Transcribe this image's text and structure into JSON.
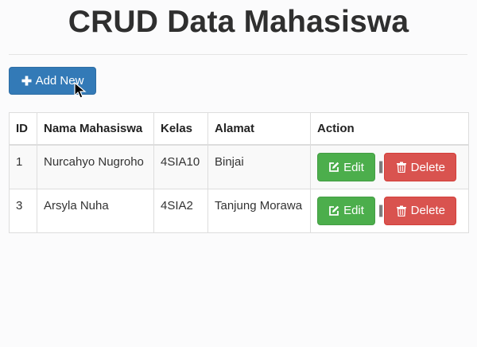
{
  "page": {
    "title": "CRUD Data Mahasiswa"
  },
  "toolbar": {
    "add_label": "Add New",
    "add_icon": "plus-icon"
  },
  "table": {
    "headers": {
      "id": "ID",
      "nama": "Nama Mahasiswa",
      "kelas": "Kelas",
      "alamat": "Alamat",
      "action": "Action"
    },
    "rows": [
      {
        "id": "1",
        "nama": "Nurcahyo Nugroho",
        "kelas": "4SIA10",
        "alamat": "Binjai"
      },
      {
        "id": "3",
        "nama": "Arsyla Nuha",
        "kelas": "4SIA2",
        "alamat": "Tanjung Morawa"
      }
    ],
    "actions": {
      "edit_label": "Edit",
      "edit_icon": "edit-icon",
      "separator": "||",
      "delete_label": "Delete",
      "delete_icon": "trash-icon"
    }
  },
  "colors": {
    "primary": "#337ab7",
    "success": "#4cae4c",
    "danger": "#d9534f"
  }
}
